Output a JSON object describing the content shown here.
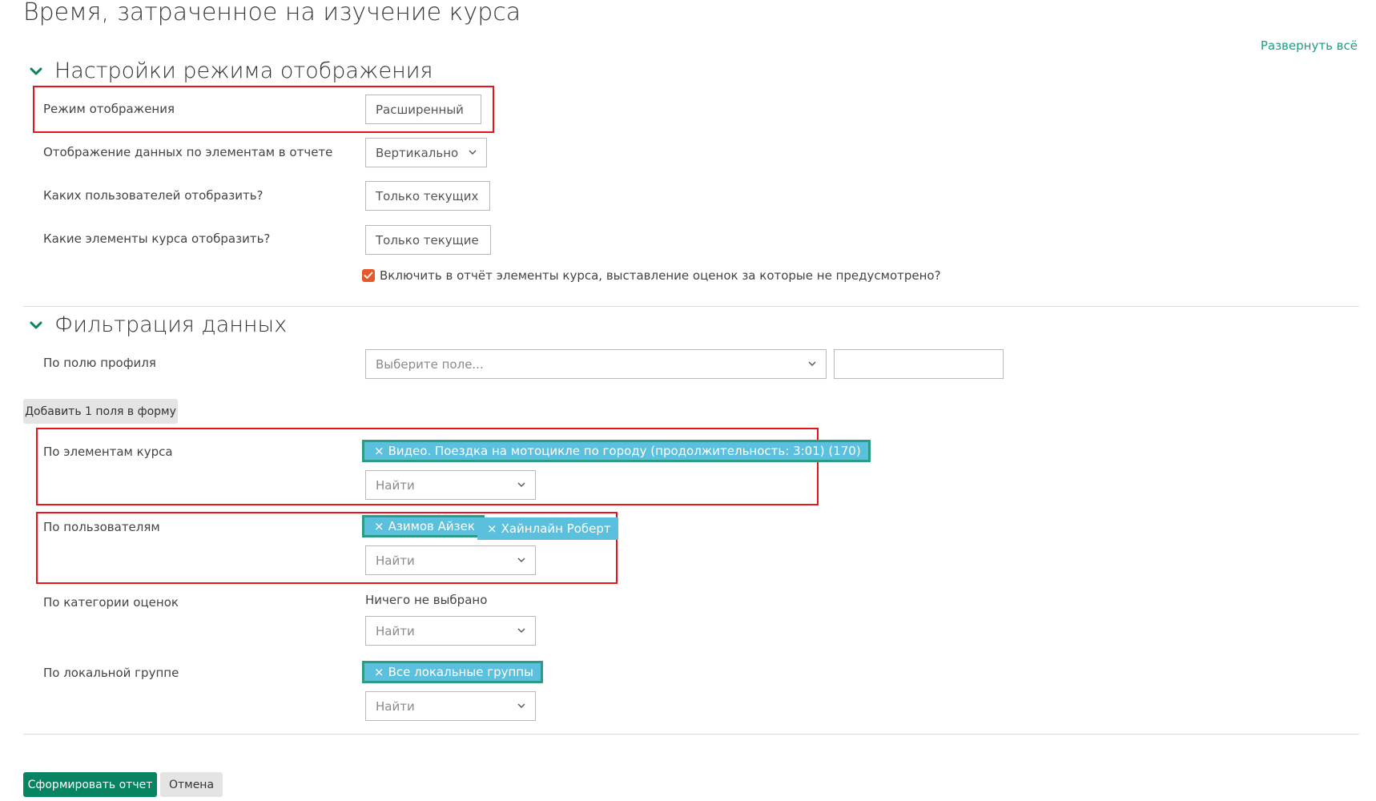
{
  "page": {
    "title": "Время, затраченное на изучение курса",
    "expand_all": "Развернуть всё"
  },
  "display_settings": {
    "title": "Настройки режима отображения",
    "mode": {
      "label": "Режим отображения",
      "value": "Расширенный"
    },
    "data_display": {
      "label": "Отображение данных по элементам в отчете",
      "value": "Вертикально"
    },
    "users": {
      "label": "Каких пользователей отобразить?",
      "value": "Только текущих"
    },
    "elements": {
      "label": "Какие элементы курса отобразить?",
      "value": "Только текущие"
    },
    "include_ungraded": {
      "label": "Включить в отчёт элементы курса, выставление оценок за которые не предусмотрено?",
      "checked": true
    }
  },
  "filters": {
    "title": "Фильтрация данных",
    "profile_field": {
      "label": "По полю профиля",
      "placeholder": "Выберите поле...",
      "value": ""
    },
    "add_field_button": "Добавить 1 поля в форму",
    "course_elements": {
      "label": "По элементам курса",
      "tags": [
        "Видео. Поездка на мотоцикле по городу (продолжительность: 3:01) (170)"
      ],
      "search_placeholder": "Найти"
    },
    "users": {
      "label": "По пользователям",
      "tags": [
        "Азимов Айзек",
        "Хайнлайн Роберт"
      ],
      "search_placeholder": "Найти"
    },
    "grade_category": {
      "label": "По категории оценок",
      "note": "Ничего не выбрано",
      "search_placeholder": "Найти"
    },
    "local_group": {
      "label": "По локальной группе",
      "tags": [
        "Все локальные группы"
      ],
      "search_placeholder": "Найти"
    }
  },
  "actions": {
    "submit": "Сформировать отчет",
    "cancel": "Отмена"
  },
  "colors": {
    "accent": "#088462",
    "link": "#1aa085",
    "tag": "#5bc0de",
    "highlight": "#e3161d",
    "checkbox": "#e6572c"
  },
  "icons": {
    "tag_remove": "×"
  }
}
